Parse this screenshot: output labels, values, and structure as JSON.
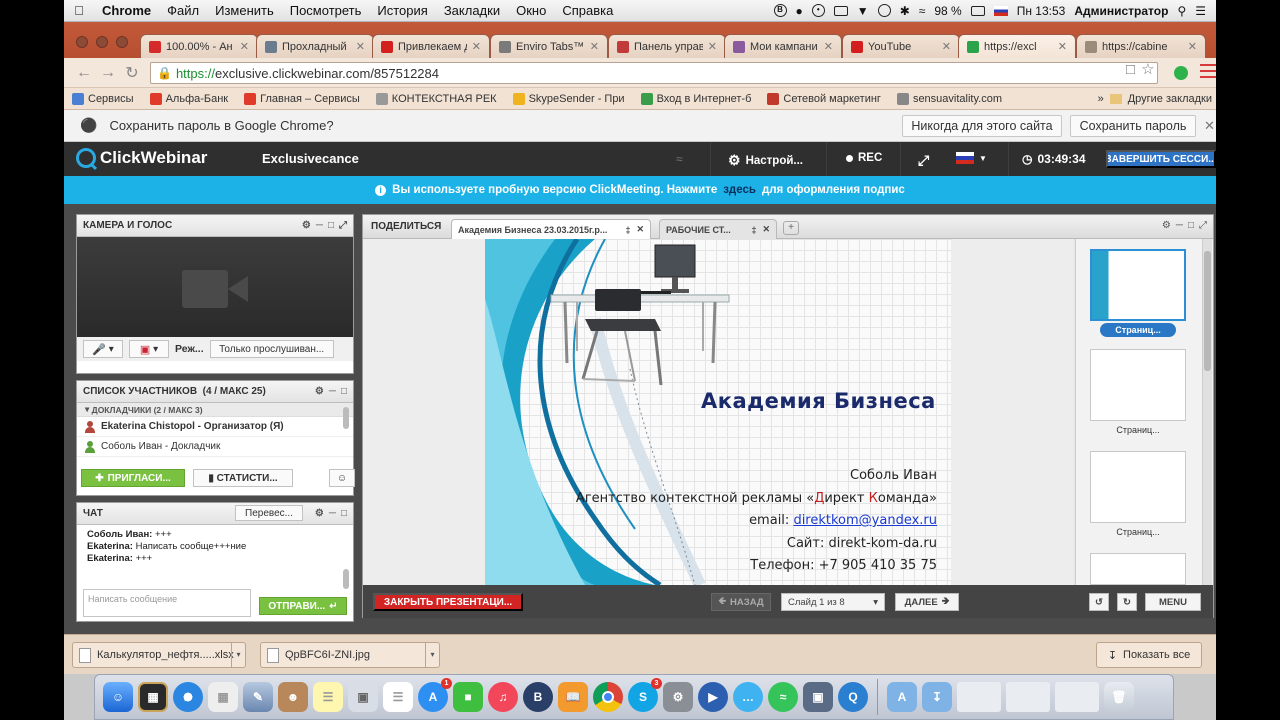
{
  "menubar": {
    "app": "Chrome",
    "items": [
      "Файл",
      "Изменить",
      "Посмотреть",
      "История",
      "Закладки",
      "Окно",
      "Справка"
    ],
    "battery": "98 %",
    "time": "Пн 13:53",
    "user": "Администратор"
  },
  "tabs": [
    {
      "title": "100.00% - Ан",
      "color": "#d42a2a"
    },
    {
      "title": "Прохладный",
      "color": "#6b7c8f"
    },
    {
      "title": "Привлекаем д",
      "color": "#d41f1f"
    },
    {
      "title": "Enviro Tabs™",
      "color": "#7a7a7a"
    },
    {
      "title": "Панель управ",
      "color": "#c23b3b"
    },
    {
      "title": "Мои кампани",
      "color": "#8a5a9e"
    },
    {
      "title": "YouTube",
      "color": "#d41f1f"
    },
    {
      "title": "https://excl",
      "color": "#2aa34a"
    },
    {
      "title": "https://cabine",
      "color": "#9b8b7a"
    }
  ],
  "omnibox": {
    "https": "https://",
    "rest": "exclusive.clickwebinar.com/857512284"
  },
  "bookmarks": [
    {
      "label": "Сервисы",
      "color": "#4a7fd4"
    },
    {
      "label": "Альфа-Банк",
      "color": "#e03a2a"
    },
    {
      "label": "Главная – Сервисы",
      "color": "#e03a2a"
    },
    {
      "label": "КОНТЕКСТНАЯ РЕК",
      "color": "#999"
    },
    {
      "label": "SkypeSender - При",
      "color": "#f0b320"
    },
    {
      "label": "Вход в Интернет-б",
      "color": "#3a9d4a"
    },
    {
      "label": "Сетевой маркетинг",
      "color": "#c0392b"
    },
    {
      "label": "sensuavitality.com",
      "color": "#888"
    }
  ],
  "bookmarks_more": "»",
  "other_bookmarks": "Другие закладки",
  "password_bar": {
    "prompt": "Сохранить пароль в Google Chrome?",
    "never": "Никогда для этого сайта",
    "save": "Сохранить пароль"
  },
  "cw_header": {
    "logo": "ClickWebinar",
    "room": "Exclusivecance",
    "settings": "Настрой...",
    "rec": "REC",
    "timer": "03:49:34",
    "end": "ЗАВЕРШИТЬ СЕССИ..."
  },
  "trial": {
    "before": "Вы используете пробную версию ClickMeeting. Нажмите",
    "link": "здесь",
    "after": "для оформления подпис"
  },
  "camera_panel": {
    "title": "КАМЕРА И ГОЛОС",
    "mode": "Реж...",
    "listen": "Только прослушиван..."
  },
  "participants_panel": {
    "title": "СПИСОК УЧАСТНИКОВ",
    "count": "(4 / МАКС 25)",
    "group": "ДОКЛАДЧИКИ (2 / МАКС 3)",
    "people": [
      {
        "name": "Ekaterina Chistopol - Организатор (Я)",
        "color": "#b2473a",
        "bold": true
      },
      {
        "name": "Соболь Иван - Докладчик",
        "color": "#5aa03a",
        "bold": false
      }
    ],
    "invite": "ПРИГЛАСИ...",
    "stats": "СТАТИСТИ..."
  },
  "chat_panel": {
    "title": "ЧАТ",
    "translate": "Перевес...",
    "messages": [
      {
        "who": "Соболь Иван:",
        "text": "+++"
      },
      {
        "who": "Ekaterina:",
        "text": "Написать сообще+++ние"
      },
      {
        "who": "Ekaterina:",
        "text": "+++"
      }
    ],
    "placeholder": "Написать сообщение",
    "send": "ОТПРАВИ..."
  },
  "share_panel": {
    "label": "ПОДЕЛИТЬСЯ",
    "tab_active": "Академия Бизнеса 23.03.2015г.р...",
    "tab_inactive": "РАБОЧИЕ СТ...",
    "close": "ЗАКРЫТЬ ПРЕЗЕНТАЦИ...",
    "prev": "НАЗАД",
    "slide_select": "Слайд 1 из 8",
    "next": "ДАЛЕЕ",
    "menu": "MENU",
    "thumb_label_active": "Страниц...",
    "thumb_label": "Страниц..."
  },
  "slide": {
    "title": "Академия Бизнеса",
    "name": "Соболь Иван",
    "agency_pre": "Агентство контекстной рекламы «",
    "agency_d": "Д",
    "agency_mid": "ирект ",
    "agency_k": "К",
    "agency_post": "оманда»",
    "email_label": "email:",
    "email": "direktkom@yandex.ru",
    "site": "Сайт: direkt-kom-da.ru",
    "phone": "Телефон: +7 905 410 35 75"
  },
  "downloads": {
    "file1": "Калькулятор_нефтя.....xlsx",
    "file2": "QpBFC6I-ZNI.jpg",
    "show_all": "Показать все"
  },
  "dock_badges": {
    "appstore": "1",
    "skype": "3"
  }
}
